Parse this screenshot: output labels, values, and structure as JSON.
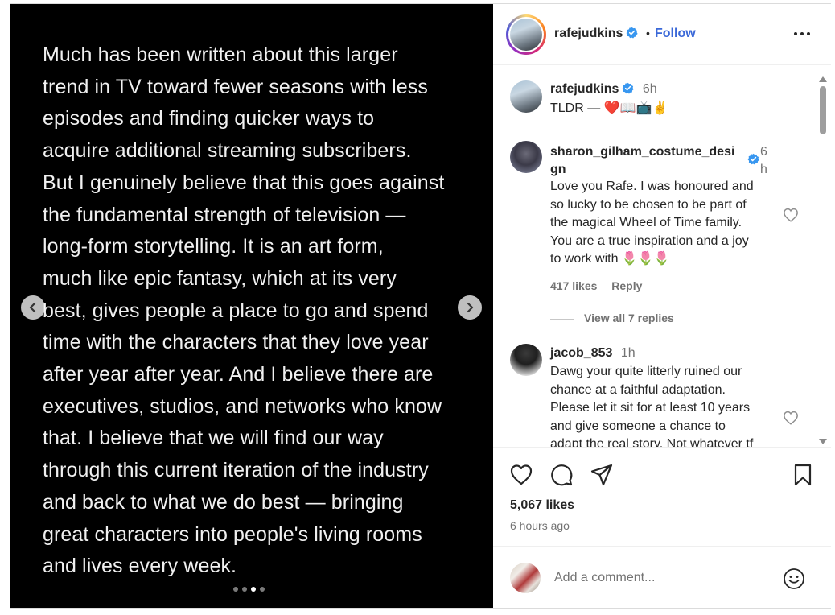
{
  "media": {
    "lines": [
      "Much has been written about this larger",
      "trend in TV toward fewer seasons with less",
      "episodes and finding quicker ways to",
      "acquire additional streaming subscribers.",
      "But I genuinely believe that this goes against",
      "the fundamental strength of television —",
      "long-form storytelling.  It is an art form,",
      "much like epic fantasy, which at its very",
      "best, gives people a place to go and spend",
      "time with the characters that they love year",
      "after year after year.  And I believe there are",
      "executives, studios, and networks who know",
      "that.  I believe that we will find our way",
      "through this current iteration of the industry",
      "and back to what we do best — bringing",
      "great characters into people's living rooms",
      "and lives every week."
    ],
    "slide_count": 4,
    "active_slide": 3
  },
  "header": {
    "username": "rafejudkins",
    "separator": "•",
    "follow_label": "Follow"
  },
  "comments": [
    {
      "username": "rafejudkins",
      "time": "6h",
      "text": "TLDR — ❤️📖📺✌️"
    },
    {
      "username_line1": "sharon_gilham_costume_desi",
      "username_line2": "gn",
      "time_line1": "6",
      "time_line2": "h",
      "text_lines": [
        "Love you Rafe. I was honoured and",
        "so lucky to be chosen to be part of",
        "the magical Wheel of Time family.",
        "You are a true inspiration and a joy",
        "to work with 🌷🌷🌷"
      ],
      "likes": "417 likes",
      "reply_label": "Reply",
      "view_replies": "View all 7 replies"
    },
    {
      "username": "jacob_853",
      "time": "1h",
      "text_lines": [
        "Dawg your quite litterly ruined our",
        "chance at a faithful adaptation.",
        "Please let it sit for at least 10 years",
        "and give someone a chance to",
        "adapt the real story. Not whatever tf"
      ]
    }
  ],
  "footer": {
    "likes": "5,067 likes",
    "posted": "6 hours ago",
    "comment_placeholder": "Add a comment..."
  },
  "colors": {
    "accent": "#3a68d8",
    "verified": "#3897f0",
    "muted": "#737373"
  },
  "icons": [
    "chevron-left-icon",
    "chevron-right-icon",
    "verified-badge-icon",
    "more-icon",
    "heart-icon",
    "comment-icon",
    "share-icon",
    "bookmark-icon",
    "emoji-icon"
  ]
}
